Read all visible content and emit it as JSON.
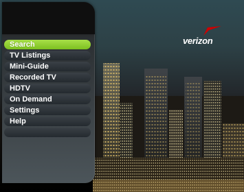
{
  "brand": {
    "logo_text": "verizon",
    "check_color": "#cc0000"
  },
  "menu": {
    "items": [
      {
        "label": "Search",
        "selected": true
      },
      {
        "label": "TV Listings",
        "selected": false
      },
      {
        "label": "Mini-Guide",
        "selected": false
      },
      {
        "label": "Recorded TV",
        "selected": false
      },
      {
        "label": "HDTV",
        "selected": false
      },
      {
        "label": "On Demand",
        "selected": false
      },
      {
        "label": "Settings",
        "selected": false
      },
      {
        "label": "Help",
        "selected": false
      },
      {
        "label": "",
        "selected": false
      }
    ]
  },
  "colors": {
    "selected_accent": "#94d43a",
    "menu_item": "#2c3237"
  }
}
